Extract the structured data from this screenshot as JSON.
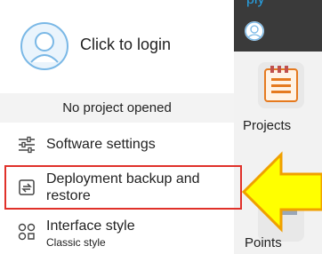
{
  "drawer": {
    "login": {
      "label": "Click to login",
      "avatar_icon": "user-avatar-icon"
    },
    "project_status": "No project opened",
    "menu": [
      {
        "label": "Software settings",
        "icon": "sliders-icon"
      },
      {
        "label": "Deployment backup and restore",
        "icon": "backup-restore-icon",
        "highlighted": true
      },
      {
        "label": "Interface style",
        "sublabel": "Classic style",
        "icon": "style-icon"
      }
    ]
  },
  "background_app": {
    "title_partial": "ply",
    "items": [
      {
        "label": "Projects",
        "icon": "projects-icon"
      },
      {
        "label": "Points",
        "icon": "points-icon"
      }
    ]
  },
  "annotation": {
    "highlight_color": "#e0312a",
    "arrow_fill": "#ffff00",
    "arrow_stroke": "#f0a000"
  }
}
